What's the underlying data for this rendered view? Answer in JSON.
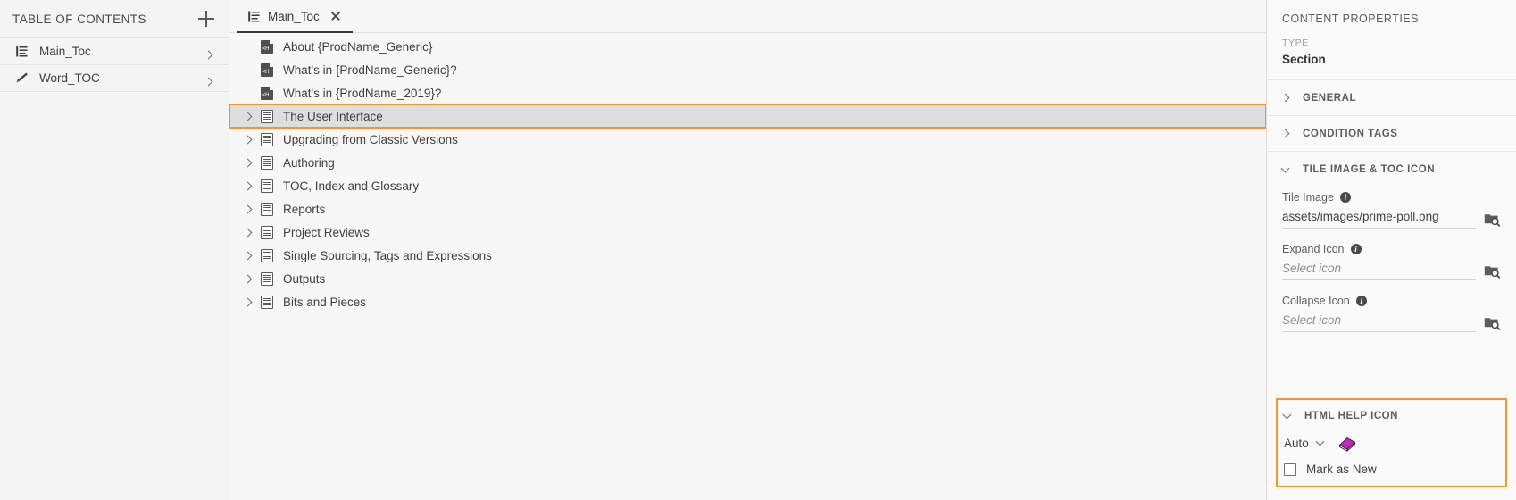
{
  "sidebar": {
    "title": "TABLE OF CONTENTS",
    "add_icon": "plus-icon",
    "items": [
      {
        "label": "Main_Toc",
        "icon": "toc-lines-icon",
        "chevron": "chevron-right-icon"
      },
      {
        "label": "Word_TOC",
        "icon": "pen-icon",
        "chevron": "chevron-right-icon"
      }
    ]
  },
  "tabs": [
    {
      "label": "Main_Toc",
      "icon": "toc-lines-icon",
      "close_icon": "close-icon",
      "active": true
    }
  ],
  "tree": {
    "rows": [
      {
        "label": "About {ProdName_Generic}",
        "icon": "html-topic-icon",
        "twisty": false,
        "selected": false,
        "highlighted": false
      },
      {
        "label": "What's in {ProdName_Generic}?",
        "icon": "html-topic-icon",
        "twisty": false,
        "selected": false,
        "highlighted": false
      },
      {
        "label": "What's in {ProdName_2019}?",
        "icon": "html-topic-icon",
        "twisty": false,
        "selected": false,
        "highlighted": false
      },
      {
        "label": "The User Interface",
        "icon": "section-icon",
        "twisty": true,
        "selected": true,
        "highlighted": true
      },
      {
        "label": "Upgrading from Classic Versions",
        "icon": "section-icon",
        "twisty": true,
        "selected": false,
        "highlighted": false
      },
      {
        "label": "Authoring",
        "icon": "section-icon",
        "twisty": true,
        "selected": false,
        "highlighted": false
      },
      {
        "label": "TOC, Index and Glossary",
        "icon": "section-icon",
        "twisty": true,
        "selected": false,
        "highlighted": false
      },
      {
        "label": "Reports",
        "icon": "section-icon",
        "twisty": true,
        "selected": false,
        "highlighted": false
      },
      {
        "label": "Project Reviews",
        "icon": "section-icon",
        "twisty": true,
        "selected": false,
        "highlighted": false
      },
      {
        "label": "Single Sourcing, Tags and Expressions",
        "icon": "section-icon",
        "twisty": true,
        "selected": false,
        "highlighted": false
      },
      {
        "label": "Outputs",
        "icon": "section-icon",
        "twisty": true,
        "selected": false,
        "highlighted": false
      },
      {
        "label": "Bits and Pieces",
        "icon": "section-icon",
        "twisty": true,
        "selected": false,
        "highlighted": false
      }
    ]
  },
  "properties": {
    "header": "CONTENT PROPERTIES",
    "type_label": "TYPE",
    "type_value": "Section",
    "sections": {
      "general": {
        "label": "GENERAL",
        "expanded": false,
        "chevron": "chevron-right-icon"
      },
      "condition_tags": {
        "label": "CONDITION TAGS",
        "expanded": false,
        "chevron": "chevron-right-icon"
      },
      "tile_image": {
        "label": "TILE IMAGE & TOC ICON",
        "expanded": true,
        "chevron": "chevron-down-icon"
      },
      "html_help": {
        "label": "HTML HELP ICON",
        "expanded": true,
        "chevron": "chevron-down-icon"
      }
    },
    "fields": {
      "tile_image": {
        "label": "Tile Image",
        "value": "assets/images/prime-poll.png",
        "placeholder": "",
        "info_icon": "info-icon",
        "browse_icon": "browse-folder-icon"
      },
      "expand_icon": {
        "label": "Expand Icon",
        "value": "",
        "placeholder": "Select icon",
        "info_icon": "info-icon",
        "browse_icon": "browse-folder-icon"
      },
      "collapse_icon": {
        "label": "Collapse Icon",
        "value": "",
        "placeholder": "Select icon",
        "info_icon": "info-icon",
        "browse_icon": "browse-folder-icon"
      }
    },
    "html_help": {
      "dropdown_value": "Auto",
      "dropdown_chevron": "chevron-down-icon",
      "book_icon": "book-icon",
      "checkbox_label": "Mark as New",
      "checkbox_checked": false
    }
  },
  "colors": {
    "highlight": "#f2952b",
    "selected_row": "#dedede",
    "book_icon": "#cc22cc",
    "panel_bg": "#fafafa",
    "sidebar_bg": "#f4f4f4",
    "tree_bg": "#f7f7f7"
  }
}
